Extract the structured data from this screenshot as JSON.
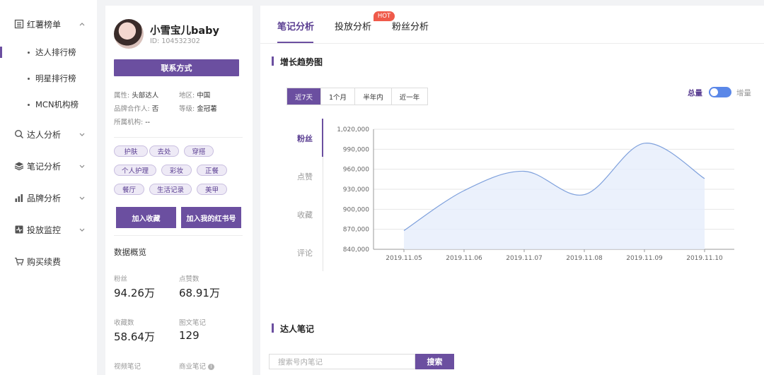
{
  "sidebar": {
    "groups": [
      {
        "label": "红薯榜单",
        "icon": "list-icon"
      },
      {
        "label": "达人分析",
        "icon": "search-icon"
      },
      {
        "label": "笔记分析",
        "icon": "layers-icon"
      },
      {
        "label": "品牌分析",
        "icon": "bar-chart-icon"
      },
      {
        "label": "投放监控",
        "icon": "monitor-icon"
      },
      {
        "label": "购买续费",
        "icon": "cart-icon"
      }
    ],
    "subitems": [
      {
        "label": "达人排行榜"
      },
      {
        "label": "明星排行榜"
      },
      {
        "label": "MCN机构榜"
      }
    ]
  },
  "profile": {
    "name": "小雪宝儿baby",
    "id": "ID:  104532302",
    "contact_btn": "联系方式",
    "attr_label": "属性:",
    "attr_value": "头部达人",
    "region_label": "地区:",
    "region_value": "中国",
    "brand_label": "品牌合作人:",
    "brand_value": "否",
    "level_label": "等级:",
    "level_value": "金冠薯",
    "org_label": "所属机构:",
    "org_value": "--",
    "tags": [
      "护肤",
      "去处",
      "穿搭",
      "个人护理",
      "彩妆",
      "正餐",
      "餐厅",
      "生活记录",
      "美甲"
    ],
    "fav_btn": "加入收藏",
    "add_btn": "加入我的红书号",
    "overview_title": "数据概览",
    "stats": [
      {
        "label": "粉丝",
        "value": "94.26万"
      },
      {
        "label": "点赞数",
        "value": "68.91万"
      },
      {
        "label": "收藏数",
        "value": "58.64万"
      },
      {
        "label": "图文笔记",
        "value": "129"
      },
      {
        "label": "视频笔记",
        "value": ""
      },
      {
        "label": "商业笔记",
        "value": ""
      }
    ]
  },
  "main": {
    "tabs": [
      {
        "label": "笔记分析"
      },
      {
        "label": "投放分析"
      },
      {
        "label": "粉丝分析"
      }
    ],
    "hot_badge": "HOT",
    "growth_title": "增长趋势图",
    "ranges": [
      "近7天",
      "1个月",
      "半年内",
      "近一年"
    ],
    "toggle_total": "总量",
    "toggle_inc": "增量",
    "metrics": [
      "粉丝",
      "点赞",
      "收藏",
      "评论"
    ],
    "notes_title": "达人笔记",
    "search_placeholder": "搜索号内笔记",
    "search_btn": "搜索"
  },
  "chart_data": {
    "type": "area",
    "x": [
      "2019.11.05",
      "2019.11.06",
      "2019.11.07",
      "2019.11.08",
      "2019.11.09",
      "2019.11.10"
    ],
    "series": [
      {
        "values": [
          868000,
          928000,
          957000,
          922000,
          999000,
          946000
        ]
      }
    ],
    "ylim": [
      840000,
      1020000
    ],
    "yticks": [
      "840,000",
      "870,000",
      "900,000",
      "930,000",
      "960,000",
      "990,000",
      "1,020,000"
    ],
    "grid": true,
    "colors": {
      "line": "#7ea0dc",
      "fill": "#e6edfb"
    }
  }
}
